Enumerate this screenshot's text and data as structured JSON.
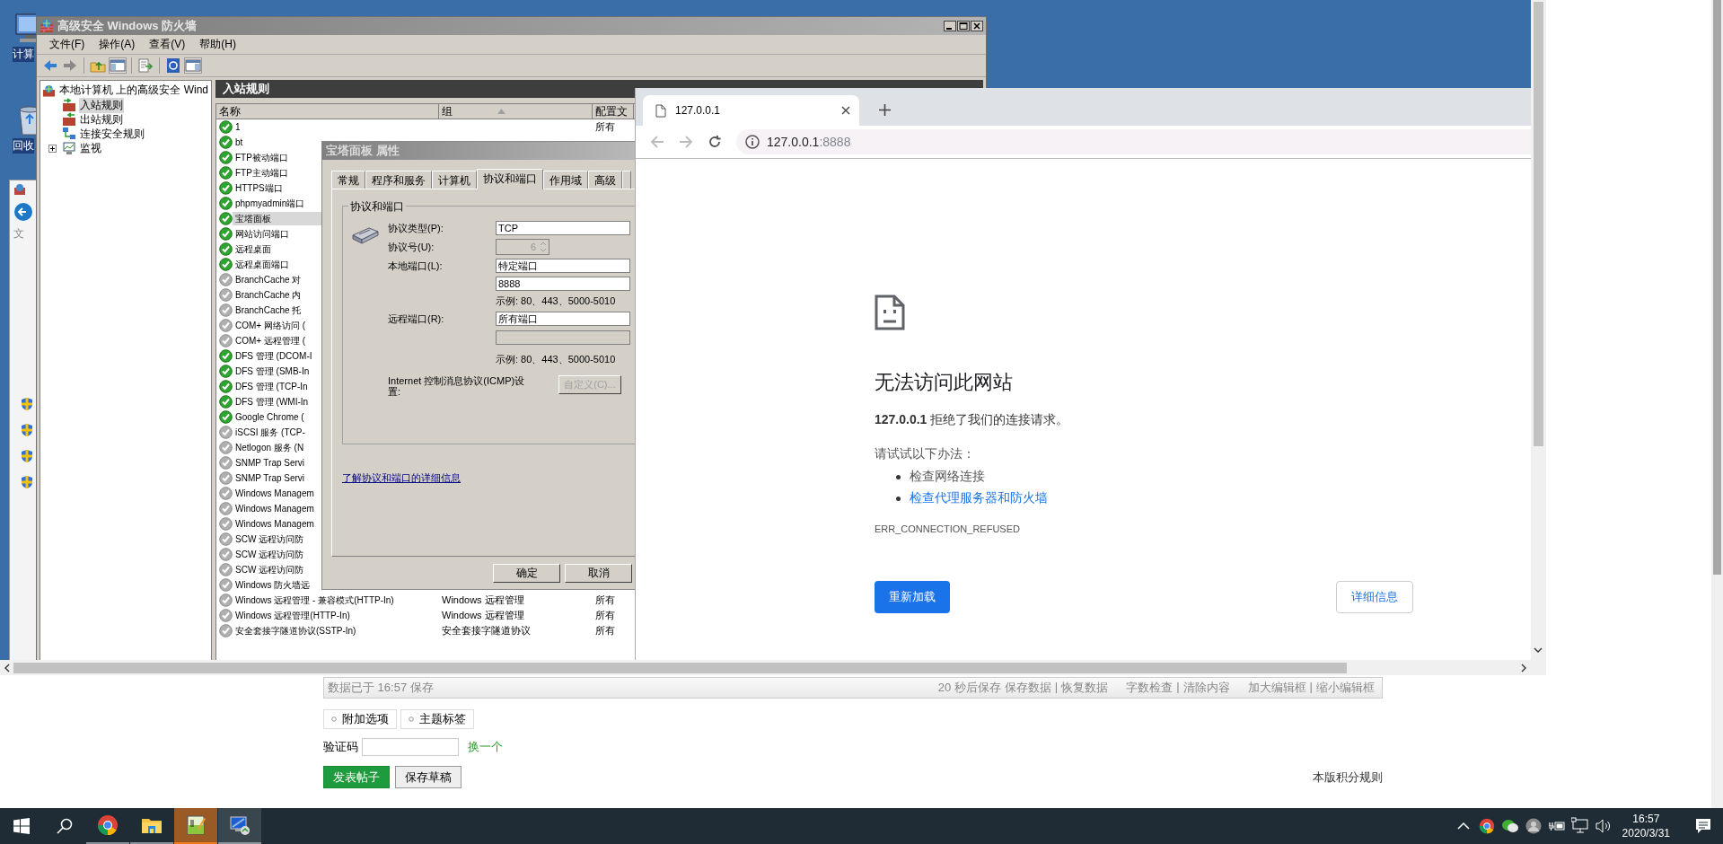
{
  "desktop": {
    "icons": [
      {
        "label": "计算",
        "kind": "computer"
      },
      {
        "label": "回收",
        "kind": "recycle"
      }
    ],
    "side_window": {
      "label": "文"
    }
  },
  "firewall": {
    "title": "高级安全 Windows 防火墙",
    "menu": [
      "文件(F)",
      "操作(A)",
      "查看(V)",
      "帮助(H)"
    ],
    "tree": {
      "label": "本地计算机 上的高级安全 Wind",
      "children": [
        {
          "label": "入站规则",
          "kind": "inbound",
          "selected": true
        },
        {
          "label": "出站规则",
          "kind": "outbound",
          "selected": false
        },
        {
          "label": "连接安全规则",
          "kind": "security",
          "selected": false
        },
        {
          "label": "监视",
          "kind": "monitor",
          "selected": false,
          "expanded": false
        }
      ]
    },
    "panel_title": "入站规则",
    "columns": [
      {
        "label": "名称",
        "sorted": false
      },
      {
        "label": "组",
        "sorted": true
      },
      {
        "label": "配置文",
        "sorted": false
      }
    ],
    "rows": [
      {
        "name": "1",
        "enabled": true,
        "selected": false,
        "profile": "所有"
      },
      {
        "name": "bt",
        "enabled": true,
        "selected": false
      },
      {
        "name": "FTP被动端口",
        "enabled": true,
        "selected": false
      },
      {
        "name": "FTP主动端口",
        "enabled": true,
        "selected": false
      },
      {
        "name": "HTTPS端口",
        "enabled": true,
        "selected": false
      },
      {
        "name": "phpmyadmin端口",
        "enabled": true,
        "selected": false
      },
      {
        "name": "宝塔面板",
        "enabled": true,
        "selected": true
      },
      {
        "name": "网站访问端口",
        "enabled": true,
        "selected": false
      },
      {
        "name": "远程桌面",
        "enabled": true,
        "selected": false
      },
      {
        "name": "远程桌面端口",
        "enabled": true,
        "selected": false
      },
      {
        "name": "BranchCache 对",
        "enabled": false,
        "selected": false
      },
      {
        "name": "BranchCache 内",
        "enabled": false,
        "selected": false
      },
      {
        "name": "BranchCache 托",
        "enabled": false,
        "selected": false
      },
      {
        "name": "COM+ 网络访问 (",
        "enabled": false,
        "selected": false
      },
      {
        "name": "COM+ 远程管理 (",
        "enabled": false,
        "selected": false
      },
      {
        "name": "DFS 管理 (DCOM-I",
        "enabled": true,
        "selected": false
      },
      {
        "name": "DFS 管理 (SMB-In",
        "enabled": true,
        "selected": false
      },
      {
        "name": "DFS 管理 (TCP-In",
        "enabled": true,
        "selected": false
      },
      {
        "name": "DFS 管理 (WMI-In",
        "enabled": true,
        "selected": false
      },
      {
        "name": "Google Chrome (",
        "enabled": true,
        "selected": false
      },
      {
        "name": "iSCSI 服务 (TCP-",
        "enabled": false,
        "selected": false
      },
      {
        "name": "Netlogon 服务 (N",
        "enabled": false,
        "selected": false
      },
      {
        "name": "SNMP Trap Servi",
        "enabled": false,
        "selected": false
      },
      {
        "name": "SNMP Trap Servi",
        "enabled": false,
        "selected": false
      },
      {
        "name": "Windows Managem",
        "enabled": false,
        "selected": false
      },
      {
        "name": "Windows Managem",
        "enabled": false,
        "selected": false
      },
      {
        "name": "Windows Managem",
        "enabled": false,
        "selected": false
      },
      {
        "name": "SCW 远程访问防",
        "enabled": false,
        "selected": false
      },
      {
        "name": "SCW 远程访问防",
        "enabled": false,
        "selected": false
      },
      {
        "name": "SCW 远程访问防",
        "enabled": false,
        "selected": false
      },
      {
        "name": "Windows 防火墙远",
        "enabled": false,
        "selected": false
      },
      {
        "name": "Windows 远程管理 - 兼容模式(HTTP-In)",
        "enabled": false,
        "selected": false,
        "group": "Windows 远程管理",
        "profile": "所有"
      },
      {
        "name": "Windows 远程管理(HTTP-In)",
        "enabled": false,
        "selected": false,
        "group": "Windows 远程管理",
        "profile": "所有"
      },
      {
        "name": "安全套接字隧道协议(SSTP-In)",
        "enabled": false,
        "selected": false,
        "group": "安全套接字隧道协议",
        "profile": "所有"
      }
    ]
  },
  "dialog": {
    "title": "宝塔面板 属性",
    "tabs": [
      {
        "label": "常规",
        "selected": false
      },
      {
        "label": "程序和服务",
        "selected": false
      },
      {
        "label": "计算机",
        "selected": false
      },
      {
        "label": "协议和端口",
        "selected": true
      },
      {
        "label": "作用域",
        "selected": false
      },
      {
        "label": "高级",
        "selected": false
      }
    ],
    "group_title": "协议和端口",
    "protocol_type": {
      "label": "协议类型(P):",
      "value": "TCP"
    },
    "protocol_number": {
      "label": "协议号(U):",
      "value": "6",
      "disabled": true
    },
    "local_port": {
      "label": "本地端口(L):",
      "value": "特定端口",
      "ports": "8888",
      "ports_disabled": false,
      "example": "示例: 80、443、5000-5010"
    },
    "remote_port": {
      "label": "远程端口(R):",
      "value": "所有端口",
      "ports_disabled": true,
      "example": "示例: 80、443、5000-5010"
    },
    "icmp": {
      "label": "Internet 控制消息协议(ICMP)设置:",
      "button": "自定义(C)...",
      "disabled": true
    },
    "link": "了解协议和端口的详细信息",
    "buttons": [
      "确定",
      "取消"
    ]
  },
  "browser": {
    "tab": {
      "title": "127.0.0.1"
    },
    "nav": {
      "back_disabled": true,
      "forward_disabled": true
    },
    "address": {
      "host": "127.0.0.1",
      "port": ":8888"
    },
    "error": {
      "heading": "无法访问此网站",
      "message": "**127.0.0.1** 拒绝了我们的连接请求。",
      "suggest": "请试试以下办法：",
      "suggestions": [
        {
          "text": "检查网络连接",
          "kind": "text"
        },
        {
          "text": "检查代理服务器和防火墙",
          "kind": "link"
        }
      ],
      "code": "ERR_CONNECTION_REFUSED",
      "buttons": [
        {
          "label": "重新加载",
          "kind": "primary"
        },
        {
          "label": "详细信息",
          "kind": "secondary"
        }
      ]
    }
  },
  "forum": {
    "saved": "数据已于 16:57 保存",
    "action_groups": [
      [
        "20 秒后保存",
        "保存数据",
        "|",
        "恢复数据"
      ],
      [
        "字数检查",
        "|",
        "清除内容"
      ],
      [
        "加大编辑框",
        "|",
        "缩小编辑框"
      ]
    ],
    "options": [
      "附加选项",
      "主题标签"
    ],
    "captcha": {
      "label": "验证码",
      "refresh": "换一个"
    },
    "submit": [
      {
        "label": "发表帖子",
        "kind": "primary"
      },
      {
        "label": "保存草稿",
        "kind": "secondary"
      }
    ],
    "rules_link": "本版积分规则"
  },
  "taskbar": {
    "apps": [
      {
        "kind": "chrome",
        "active": false,
        "focused": false
      },
      {
        "kind": "folder",
        "active": false,
        "focused": false
      },
      {
        "kind": "notepad",
        "active": true,
        "focused": false
      },
      {
        "kind": "rdp",
        "active": false,
        "focused": true
      }
    ],
    "tray": [
      {
        "kind": "caret"
      },
      {
        "kind": "chrome"
      },
      {
        "kind": "wechat"
      },
      {
        "kind": "avatar"
      },
      {
        "kind": "power"
      },
      {
        "kind": "network"
      },
      {
        "kind": "volume"
      }
    ],
    "clock": {
      "time": "16:57",
      "date": "2020/3/31"
    }
  }
}
